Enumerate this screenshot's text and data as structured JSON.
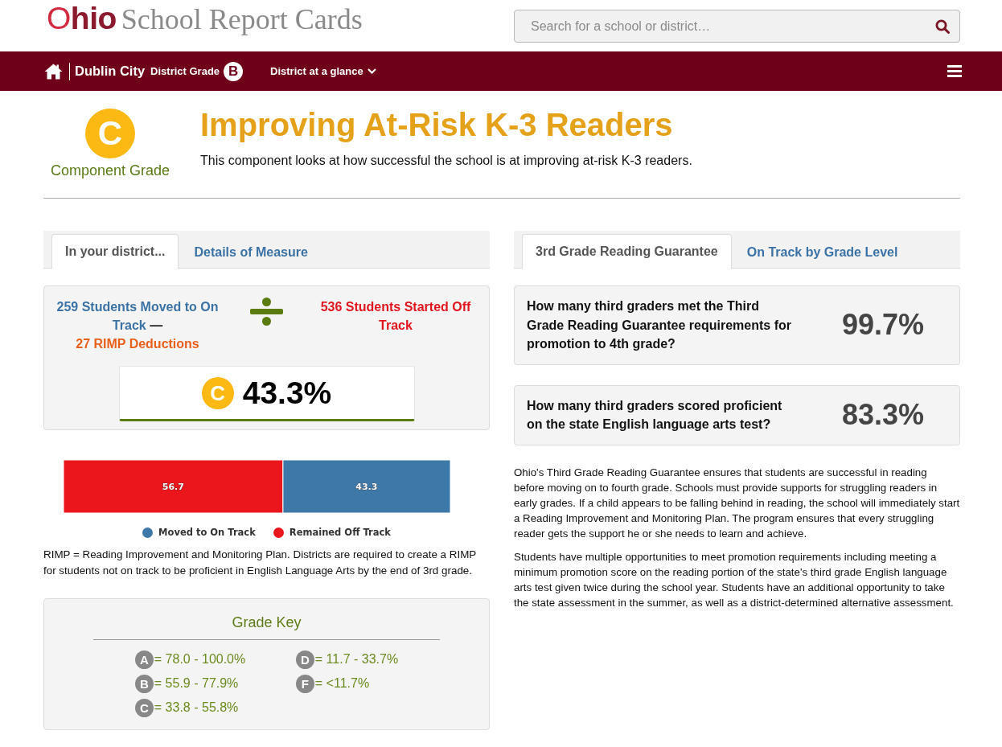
{
  "header": {
    "logo": "Ohio",
    "site_title": "School Report Cards",
    "search": {
      "placeholder": "Search for a school or district…"
    }
  },
  "nav": {
    "district": "Dublin City",
    "grade_label": "District Grade",
    "grade": "B",
    "menu": "District at a glance"
  },
  "component": {
    "grade": "C",
    "grade_label": "Component Grade",
    "title": "Improving At-Risk K-3 Readers",
    "description": "This component looks at how successful the school is at improving at-risk K-3 readers."
  },
  "left_panel": {
    "tabs": [
      {
        "label": "In your district...",
        "selected": true
      },
      {
        "label": "Details of Measure",
        "selected": false
      }
    ],
    "calculation": {
      "numerator": "259 Students Moved to On Track",
      "operator": "—",
      "deductions": "27 RIMP Deductions",
      "denominator": "536 Students Started Off Track",
      "grade": "C",
      "result": "43.3%"
    },
    "chart_data": {
      "type": "bar",
      "orientation": "horizontal",
      "stacked": true,
      "xlim": [
        100,
        0
      ],
      "data_labels": true,
      "series": [
        {
          "name": "Moved to On Track",
          "color": "#3d78a9",
          "values": [
            43.3
          ]
        },
        {
          "name": "Remained Off Track",
          "color": "#eb161c",
          "values": [
            56.7
          ]
        }
      ]
    },
    "note": "RIMP = Reading Improvement and Monitoring Plan. Districts are required to create a RIMP for students not on track to be proficient in English Language Arts by the end of 3rd grade.",
    "grade_key": {
      "title": "Grade Key",
      "items": [
        {
          "grade": "A",
          "range": "= 78.0 - 100.0%"
        },
        {
          "grade": "B",
          "range": "= 55.9 - 77.9%"
        },
        {
          "grade": "C",
          "range": "= 33.8 - 55.8%"
        },
        {
          "grade": "D",
          "range": "= 11.7 - 33.7%"
        },
        {
          "grade": "F",
          "range": "= <11.7%"
        }
      ]
    }
  },
  "right_panel": {
    "tabs": [
      {
        "label": "3rd Grade Reading Guarantee",
        "selected": true
      },
      {
        "label": "On Track by Grade Level",
        "selected": false
      }
    ],
    "cards": [
      {
        "question": "How many third graders met the Third Grade Reading Guarantee requirements for promotion to 4th grade?",
        "value": "99.7%"
      },
      {
        "question": "How many third graders scored proficient on the state English language arts test?",
        "value": "83.3%"
      }
    ],
    "paragraphs": [
      "Ohio's Third Grade Reading Guarantee ensures that students are successful in reading before moving on to fourth grade. Schools must provide supports for struggling readers in early grades. If a child appears to be falling behind in reading, the school will immediately start a Reading Improvement and Monitoring Plan. The program ensures that every struggling reader gets the support he or she needs to learn and achieve.",
      "Students have multiple opportunities to meet promotion requirements including meeting a minimum promotion score on the reading portion of the state's third grade English language arts test given twice during the school year. Students have an additional opportunity to take the state assessment in the summer, as well as a district-determined alternative assessment."
    ]
  }
}
